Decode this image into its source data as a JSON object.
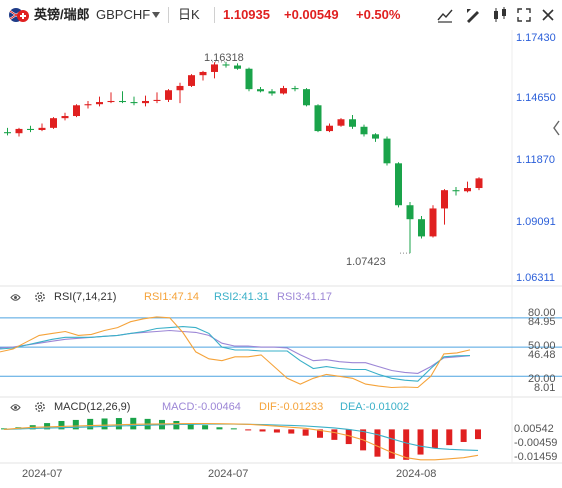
{
  "header": {
    "pair_name": "英镑/瑞郎",
    "symbol": "GBPCHF",
    "timeframe": "日K",
    "price": "1.10935",
    "change": "+0.00549",
    "change_pct": "+0.50%",
    "colors": {
      "up": "#e02020",
      "down": "#1aa34a"
    },
    "icons": [
      "flag-icon",
      "dropdown-arrow-icon",
      "indicator-settings-icon",
      "draw-tool-icon",
      "fullscreen-icon",
      "close-icon"
    ]
  },
  "main_chart": {
    "axis_labels": [
      "1.17430",
      "1.14650",
      "1.11870",
      "1.09091",
      "1.06311"
    ],
    "high_label": "1.16318",
    "low_label": "1.07423",
    "collapse_icon": "chevron-left-icon"
  },
  "rsi": {
    "title": "RSI(7,14,21)",
    "rsi1": "RSI1:47.14",
    "rsi2": "RSI2:41.31",
    "rsi3": "RSI3:41.17",
    "axis_labels": [
      "80.00",
      "84.95",
      "50.00",
      "46.48",
      "20.00",
      "8.01"
    ],
    "colors": {
      "rsi1": "#f5a33a",
      "rsi2": "#3ab0c8",
      "rsi3": "#9c86d6"
    }
  },
  "macd": {
    "title": "MACD(12,26,9)",
    "macd": "MACD:-0.00464",
    "dif": "DIF:-0.01233",
    "dea": "DEA:-0.01002",
    "axis_labels": [
      "0.00542",
      "-0.00459",
      "-0.01459"
    ],
    "colors": {
      "macd": "#9c86d6",
      "dif": "#f5a33a",
      "dea": "#3ab0c8"
    }
  },
  "x_axis": {
    "labels": [
      "2024-07",
      "2024-07",
      "2024-08"
    ]
  },
  "chart_data": {
    "type": "candlestick",
    "up_color": "#e02020",
    "down_color": "#1aa34a",
    "y_range": [
      1.06311,
      1.1743
    ],
    "candles": [
      [
        1.1305,
        1.1325,
        1.129,
        1.13
      ],
      [
        1.13,
        1.1325,
        1.1285,
        1.132
      ],
      [
        1.132,
        1.1335,
        1.1305,
        1.1315
      ],
      [
        1.1315,
        1.1345,
        1.131,
        1.1325
      ],
      [
        1.1325,
        1.1375,
        1.132,
        1.137
      ],
      [
        1.137,
        1.1395,
        1.136,
        1.138
      ],
      [
        1.138,
        1.1435,
        1.1375,
        1.143
      ],
      [
        1.143,
        1.145,
        1.1415,
        1.1435
      ],
      [
        1.1435,
        1.147,
        1.1425,
        1.1445
      ],
      [
        1.1445,
        1.149,
        1.144,
        1.145
      ],
      [
        1.145,
        1.1495,
        1.144,
        1.1445
      ],
      [
        1.1445,
        1.147,
        1.143,
        1.144
      ],
      [
        1.144,
        1.1475,
        1.1425,
        1.145
      ],
      [
        1.145,
        1.149,
        1.144,
        1.1455
      ],
      [
        1.1455,
        1.1505,
        1.1445,
        1.15
      ],
      [
        1.15,
        1.1535,
        1.144,
        1.152
      ],
      [
        1.152,
        1.1575,
        1.1515,
        1.157
      ],
      [
        1.157,
        1.159,
        1.1545,
        1.1585
      ],
      [
        1.1585,
        1.163,
        1.1555,
        1.162
      ],
      [
        1.162,
        1.1632,
        1.1605,
        1.1615
      ],
      [
        1.1615,
        1.1625,
        1.1595,
        1.16
      ],
      [
        1.16,
        1.1605,
        1.1495,
        1.1505
      ],
      [
        1.1505,
        1.1515,
        1.149,
        1.1495
      ],
      [
        1.1495,
        1.1505,
        1.1475,
        1.1485
      ],
      [
        1.1485,
        1.152,
        1.148,
        1.151
      ],
      [
        1.151,
        1.152,
        1.1495,
        1.1505
      ],
      [
        1.1505,
        1.151,
        1.1425,
        1.143
      ],
      [
        1.143,
        1.1435,
        1.1305,
        1.131
      ],
      [
        1.131,
        1.1345,
        1.1305,
        1.1335
      ],
      [
        1.1335,
        1.137,
        1.133,
        1.1365
      ],
      [
        1.1365,
        1.1385,
        1.132,
        1.133
      ],
      [
        1.133,
        1.134,
        1.1285,
        1.1295
      ],
      [
        1.1295,
        1.13,
        1.126,
        1.1275
      ],
      [
        1.1275,
        1.1285,
        1.115,
        1.116
      ],
      [
        1.116,
        1.1165,
        1.0955,
        1.0965
      ],
      [
        1.0965,
        1.098,
        1.0742,
        1.09
      ],
      [
        1.09,
        1.0915,
        1.081,
        1.082
      ],
      [
        1.082,
        1.0965,
        1.0815,
        1.095
      ],
      [
        1.095,
        1.104,
        1.0875,
        1.1035
      ],
      [
        1.1035,
        1.105,
        1.101,
        1.103
      ],
      [
        1.103,
        1.1075,
        1.1025,
        1.1045
      ],
      [
        1.1045,
        1.1095,
        1.1035,
        1.109
      ]
    ],
    "rsi_range": [
      8.01,
      84.95
    ],
    "rsi1": [
      45,
      48,
      55,
      62,
      64,
      66,
      62,
      63,
      67,
      70,
      76,
      79,
      81,
      80,
      65,
      45,
      38,
      36,
      40,
      40,
      42,
      30,
      18,
      12,
      18,
      22,
      20,
      18,
      12,
      10,
      8.5,
      9,
      8.5,
      20,
      43,
      44,
      47.14
    ],
    "rsi2": [
      48,
      49,
      52,
      55,
      58,
      60,
      60,
      60,
      61,
      62,
      64,
      66,
      69,
      70,
      71,
      70,
      64,
      50,
      47,
      47,
      46,
      46,
      46,
      36,
      28,
      30,
      28,
      27,
      27,
      22,
      18,
      16,
      15,
      28,
      40,
      41,
      41.31
    ],
    "rsi3": [
      49,
      50,
      52,
      54,
      56,
      58,
      59,
      60,
      61,
      62,
      64,
      65,
      66,
      67,
      66,
      65,
      62,
      54,
      51,
      51,
      50,
      50,
      49,
      42,
      36,
      37,
      35,
      34,
      34,
      30,
      26,
      24,
      23,
      30,
      39,
      40,
      41.17
    ],
    "macd_range": [
      -0.01459,
      0.00542
    ],
    "macd_hist": [
      0.0005,
      0.001,
      0.002,
      0.003,
      0.004,
      0.0045,
      0.005,
      0.0052,
      0.0054,
      0.0055,
      0.005,
      0.0045,
      0.004,
      0.003,
      0.002,
      0.001,
      0.0005,
      -0.0005,
      -0.001,
      -0.0015,
      -0.002,
      -0.003,
      -0.004,
      -0.005,
      -0.007,
      -0.01,
      -0.013,
      -0.014,
      -0.0145,
      -0.012,
      -0.009,
      -0.0075,
      -0.006,
      -0.00464
    ],
    "dif": [
      0.0,
      0.0005,
      0.001,
      0.0012,
      0.0014,
      0.0016,
      0.0018,
      0.002,
      0.0022,
      0.0024,
      0.0025,
      0.0026,
      0.0027,
      0.0028,
      0.0028,
      0.0027,
      0.0026,
      0.0024,
      0.002,
      0.0015,
      0.001,
      0.0005,
      -0.0005,
      -0.0015,
      -0.003,
      -0.005,
      -0.008,
      -0.011,
      -0.0135,
      -0.0145,
      -0.0145,
      -0.014,
      -0.0135,
      -0.01233
    ],
    "dea": [
      0.0,
      0.0002,
      0.0004,
      0.0006,
      0.0008,
      0.001,
      0.0012,
      0.0014,
      0.0016,
      0.0018,
      0.002,
      0.0022,
      0.0023,
      0.0024,
      0.0025,
      0.0025,
      0.0025,
      0.0024,
      0.0023,
      0.0021,
      0.0019,
      0.0016,
      0.0012,
      0.0007,
      0.0,
      -0.001,
      -0.0025,
      -0.0045,
      -0.0065,
      -0.008,
      -0.009,
      -0.0095,
      -0.0098,
      -0.01002
    ]
  }
}
